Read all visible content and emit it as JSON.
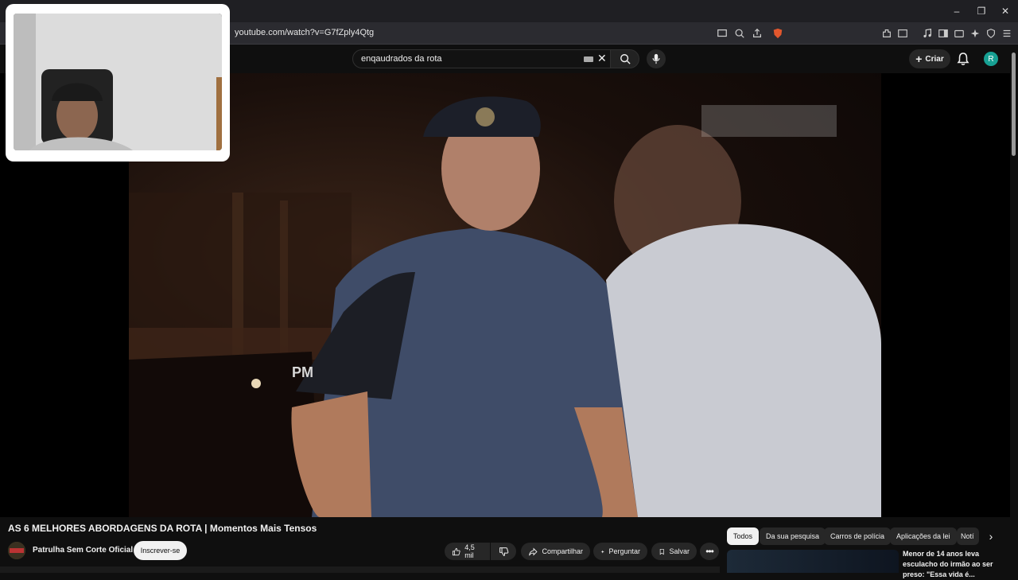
{
  "browser": {
    "url": "youtube.com/watch?v=G7fZply4Qtg",
    "window_controls": {
      "minimize": "–",
      "restore": "❐",
      "close": "✕"
    }
  },
  "header": {
    "search_query": "enqaudrados da rota",
    "create_label": "Criar",
    "avatar_letter": "R"
  },
  "video": {
    "title": "AS 6 MELHORES ABORDAGENS DA ROTA | Momentos Mais Tensos",
    "badge_text": "PM"
  },
  "channel": {
    "name": "Patrulha Sem Corte Oficial",
    "subscribe_label": "Inscrever-se"
  },
  "actions": {
    "likes": "4,5 mil",
    "share_label": "Compartilhar",
    "ask_label": "Perguntar",
    "save_label": "Salvar"
  },
  "chips": [
    "Todos",
    "Da sua pesquisa",
    "Carros de polícia",
    "Aplicações da lei",
    "Notí"
  ],
  "recommendation": {
    "title": "Menor de 14 anos leva esculacho do irmão ao ser preso: \"Essa vida é..."
  },
  "colors": {
    "background": "#0f0f0f",
    "avatar": "#17a093",
    "chip_active": "#f1f1f1"
  }
}
